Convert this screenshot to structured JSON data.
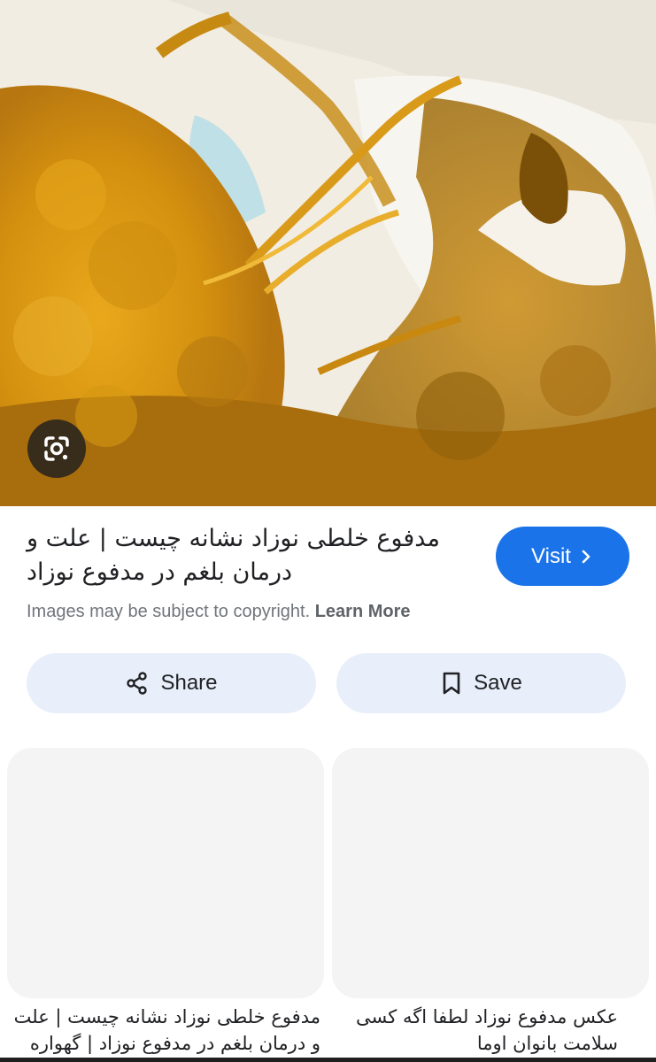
{
  "result": {
    "title": "مدفوع خلطی نوزاد نشانه چیست | علت و درمان بلغم در مدفوع نوزاد",
    "visit_label": "Visit",
    "copyright_text": "Images may be subject to copyright.",
    "learn_more_label": "Learn More"
  },
  "actions": {
    "share_label": "Share",
    "save_label": "Save"
  },
  "related": [
    {
      "caption": "مدفوع خلطی نوزاد نشانه چیست | علت و درمان بلغم در مدفوع نوزاد | گهواره"
    },
    {
      "caption": "عکس مدفوع نوزاد لطفا اگه کسی سلامت بانوان اوما"
    }
  ],
  "icons": {
    "lens": "google-lens-icon",
    "visit_arrow": "chevron-right-icon",
    "share": "share-icon",
    "save": "bookmark-icon"
  },
  "colors": {
    "accent": "#1a73e8",
    "button_bg": "#e8effa",
    "lens_bg": "#28231e"
  }
}
